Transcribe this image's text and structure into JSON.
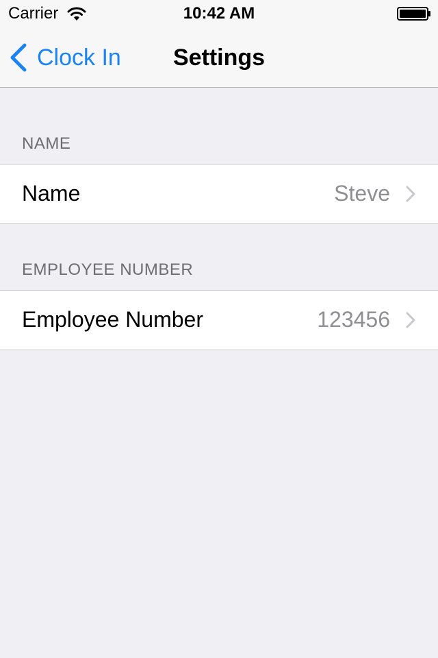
{
  "status_bar": {
    "carrier": "Carrier",
    "time": "10:42 AM"
  },
  "nav_bar": {
    "back_label": "Clock In",
    "title": "Settings"
  },
  "sections": [
    {
      "header": "NAME",
      "rows": [
        {
          "label": "Name",
          "value": "Steve",
          "accessory": "chevron-right-icon"
        }
      ]
    },
    {
      "header": "EMPLOYEE NUMBER",
      "rows": [
        {
          "label": "Employee Number",
          "value": "123456",
          "accessory": "chevron-right-icon"
        }
      ]
    }
  ],
  "colors": {
    "tint": "#1a84f5",
    "background": "#efeff4",
    "bar_background": "#f7f7f7",
    "secondary_text": "#8e8e93",
    "section_header_text": "#6d6d72",
    "separator": "#c8c7cc"
  },
  "icons": {
    "wifi": "wifi-icon",
    "battery": "battery-icon",
    "back": "chevron-left-icon",
    "disclosure": "chevron-right-icon"
  }
}
